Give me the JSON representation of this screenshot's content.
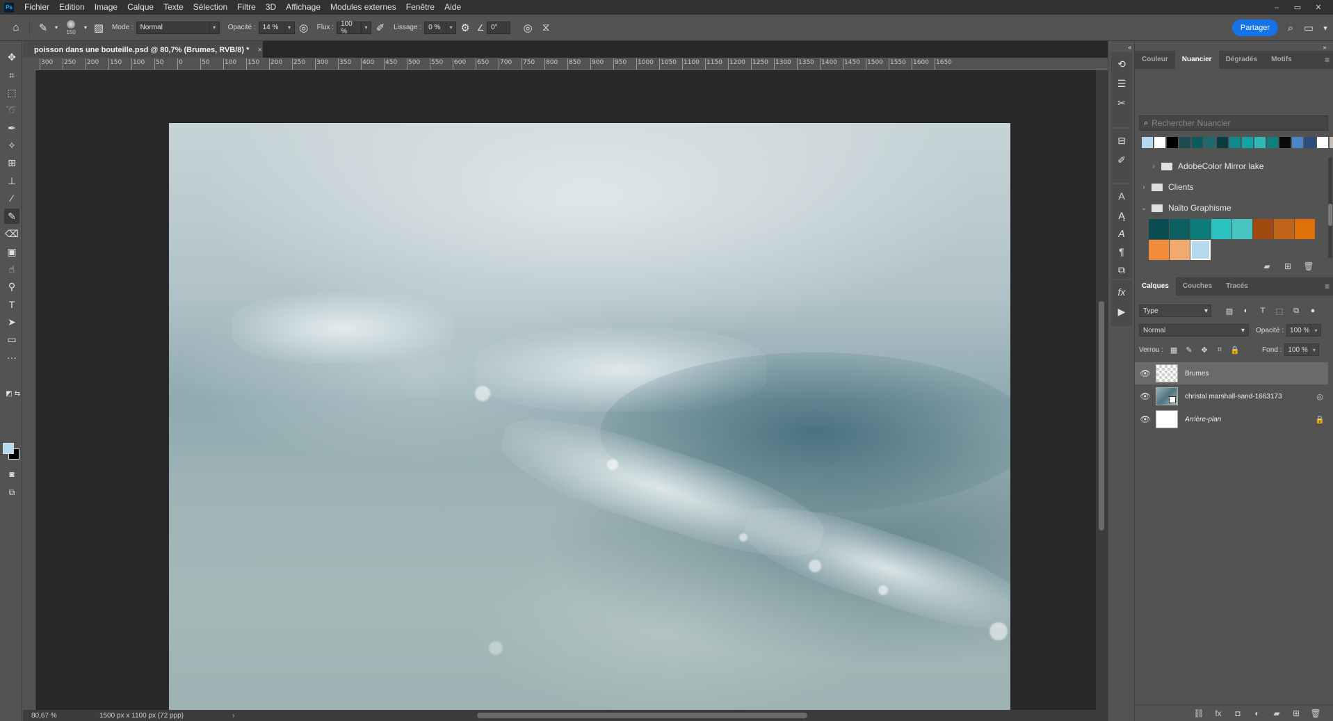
{
  "menubar": {
    "logo": "Ps",
    "items": [
      "Fichier",
      "Edition",
      "Image",
      "Calque",
      "Texte",
      "Sélection",
      "Filtre",
      "3D",
      "Affichage",
      "Modules externes",
      "Fenêtre",
      "Aide"
    ],
    "window_controls": [
      "–",
      "▭",
      "✕"
    ]
  },
  "options": {
    "brush_size": "150",
    "mode_label": "Mode :",
    "mode_value": "Normal",
    "opacity_label": "Opacité :",
    "opacity_value": "14 %",
    "flow_label": "Flux :",
    "flow_value": "100 %",
    "smoothing_label": "Lissage :",
    "smoothing_value": "0 %",
    "angle_value": "0°",
    "share_label": "Partager"
  },
  "document": {
    "tab_title": "poisson dans une bouteille.psd @ 80,7% (Brumes, RVB/8) *",
    "tab_close": "×",
    "ruler_ticks": [
      "300",
      "250",
      "200",
      "150",
      "100",
      "50",
      "0",
      "50",
      "100",
      "150",
      "200",
      "250",
      "300",
      "350",
      "400",
      "450",
      "500",
      "550",
      "600",
      "650",
      "700",
      "750",
      "800",
      "850",
      "900",
      "950",
      "1000",
      "1050",
      "1100",
      "1150",
      "1200",
      "1250",
      "1300",
      "1350",
      "1400",
      "1450",
      "1500",
      "1550",
      "1600",
      "1650"
    ],
    "zoom": "80,67 %",
    "info": "1500 px x 1100 px (72 ppp)"
  },
  "swatches": {
    "tabs": [
      "Couleur",
      "Nuancier",
      "Dégradés",
      "Motifs"
    ],
    "search_placeholder": "Rechercher Nuancier",
    "recent": [
      "#b5d9ef",
      "#ffffff",
      "#000000",
      "#1c4a4f",
      "#0d5a5c",
      "#1e6a6d",
      "#0a3b40",
      "#0f8a8a",
      "#12a5a5",
      "#2fb8b8",
      "#0f7f80",
      "#0a0a0a",
      "#4d86c6",
      "#2a4f7f",
      "#ffffff",
      "#c8c0b6"
    ],
    "groups": [
      {
        "name": "AdobeColor Mirror lake",
        "expanded": false
      },
      {
        "name": "Clients",
        "expanded": false
      },
      {
        "name": "Naïto Graphisme",
        "expanded": true
      }
    ],
    "group_colors": [
      "#0b4d50",
      "#0c5f60",
      "#0e7c7c",
      "#2cc2c0",
      "#48c4c0",
      "#a04a10",
      "#c0641a",
      "#e0700a",
      "#f08c3c",
      "#f0aa70",
      "#b5d9ef"
    ]
  },
  "layers": {
    "tabs": [
      "Calques",
      "Couches",
      "Tracés"
    ],
    "filter_label": "Type",
    "blend_mode": "Normal",
    "opacity_label": "Opacité :",
    "opacity_value": "100 %",
    "lock_label": "Verrou :",
    "fill_label": "Fond :",
    "fill_value": "100 %",
    "items": [
      {
        "name": "Brumes",
        "selected": true,
        "thumb": "transparent"
      },
      {
        "name": "christal marshall-sand-1663173",
        "selected": false,
        "thumb": "smart-object"
      },
      {
        "name": "Arrière-plan",
        "selected": false,
        "thumb": "white",
        "locked": true
      }
    ]
  },
  "colors": {
    "foreground": "#b5d9ef",
    "background": "#000000",
    "accent": "#1473e6"
  }
}
